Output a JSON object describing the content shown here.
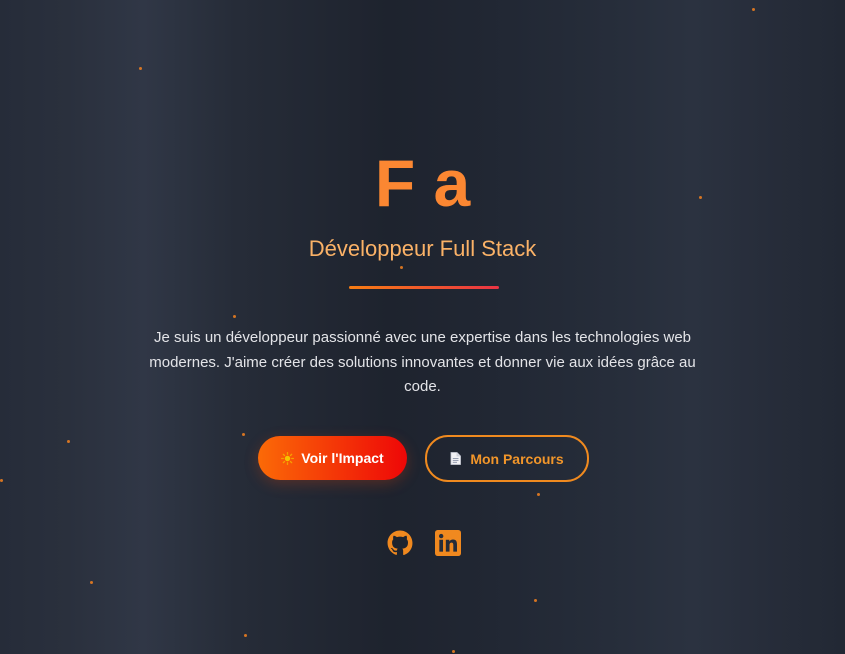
{
  "hero": {
    "title": "F a",
    "subtitle": "Développeur Full Stack",
    "bio": "Je suis un développeur passionné avec une expertise dans les technologies web modernes. J'aime créer des solutions innovantes et donner vie aux idées grâce au code."
  },
  "buttons": {
    "primary": {
      "label": "Voir l'Impact",
      "icon": "sun-icon"
    },
    "secondary": {
      "label": "Mon Parcours",
      "icon": "document-icon"
    }
  },
  "social": [
    {
      "name": "github-icon"
    },
    {
      "name": "linkedin-icon"
    }
  ],
  "colors": {
    "accent": "#fb8732",
    "subtitle": "#fbb267",
    "button_gradient_start": "#fb6a07",
    "button_gradient_end": "#ee0707",
    "background": "#232936"
  }
}
